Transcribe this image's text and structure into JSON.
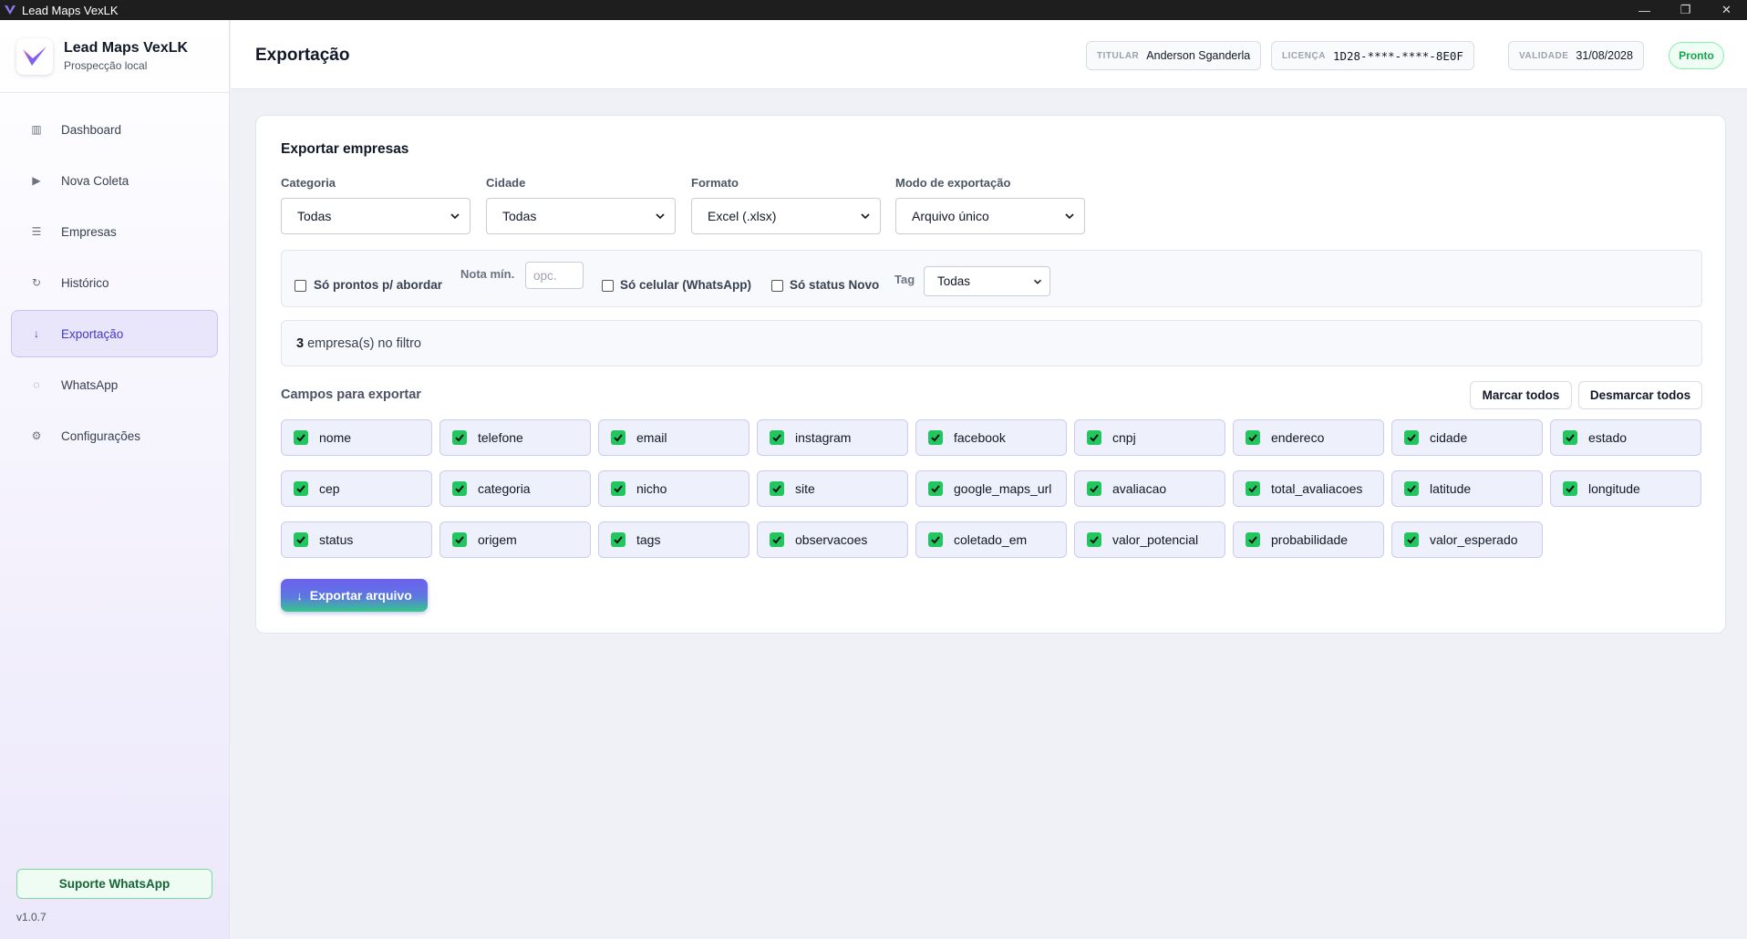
{
  "window": {
    "title": "Lead Maps VexLK",
    "controls": [
      "—",
      "❐",
      "✕"
    ]
  },
  "sidebar": {
    "brand_title": "Lead Maps VexLK",
    "brand_subtitle": "Prospecção local",
    "items": [
      {
        "label": "Dashboard",
        "icon": "▥",
        "active": false
      },
      {
        "label": "Nova Coleta",
        "icon": "▶",
        "active": false
      },
      {
        "label": "Empresas",
        "icon": "☰",
        "active": false
      },
      {
        "label": "Histórico",
        "icon": "↻",
        "active": false
      },
      {
        "label": "Exportação",
        "icon": "↓",
        "active": true
      },
      {
        "label": "WhatsApp",
        "icon": "◌",
        "active": false
      },
      {
        "label": "Configurações",
        "icon": "⚙",
        "active": false
      }
    ],
    "support_label": "Suporte WhatsApp",
    "version": "v1.0.7"
  },
  "header": {
    "title": "Exportação",
    "titular_label": "TITULAR",
    "titular_value": "Anderson Sganderla",
    "licenca_label": "LICENÇA",
    "licenca_value": "1D28-****-****-8E0F",
    "validade_label": "VALIDADE",
    "validade_value": "31/08/2028",
    "status": "Pronto"
  },
  "export": {
    "title": "Exportar empresas",
    "filters": {
      "categoria": {
        "label": "Categoria",
        "value": "Todas"
      },
      "cidade": {
        "label": "Cidade",
        "value": "Todas"
      },
      "formato": {
        "label": "Formato",
        "value": "Excel (.xlsx)"
      },
      "modo": {
        "label": "Modo de exportação",
        "value": "Arquivo único"
      }
    },
    "options": {
      "prontos": "Só prontos p/ abordar",
      "nota_label": "Nota mín.",
      "nota_placeholder": "opc.",
      "celular": "Só celular (WhatsApp)",
      "status_novo": "Só status Novo",
      "tag_label": "Tag",
      "tag_value": "Todas"
    },
    "count_number": "3",
    "count_text": "empresa(s) no filtro",
    "fields_title": "Campos para exportar",
    "mark_all": "Marcar todos",
    "unmark_all": "Desmarcar todos",
    "fields": [
      "nome",
      "telefone",
      "email",
      "instagram",
      "facebook",
      "cnpj",
      "endereco",
      "cidade",
      "estado",
      "cep",
      "categoria",
      "nicho",
      "site",
      "google_maps_url",
      "avaliacao",
      "total_avaliacoes",
      "latitude",
      "longitude",
      "status",
      "origem",
      "tags",
      "observacoes",
      "coletado_em",
      "valor_potencial",
      "probabilidade",
      "valor_esperado"
    ],
    "export_button": "Exportar arquivo"
  },
  "colors": {
    "accent": "#4338ca",
    "check": "#22c55e",
    "status_green": "#16a34a"
  }
}
